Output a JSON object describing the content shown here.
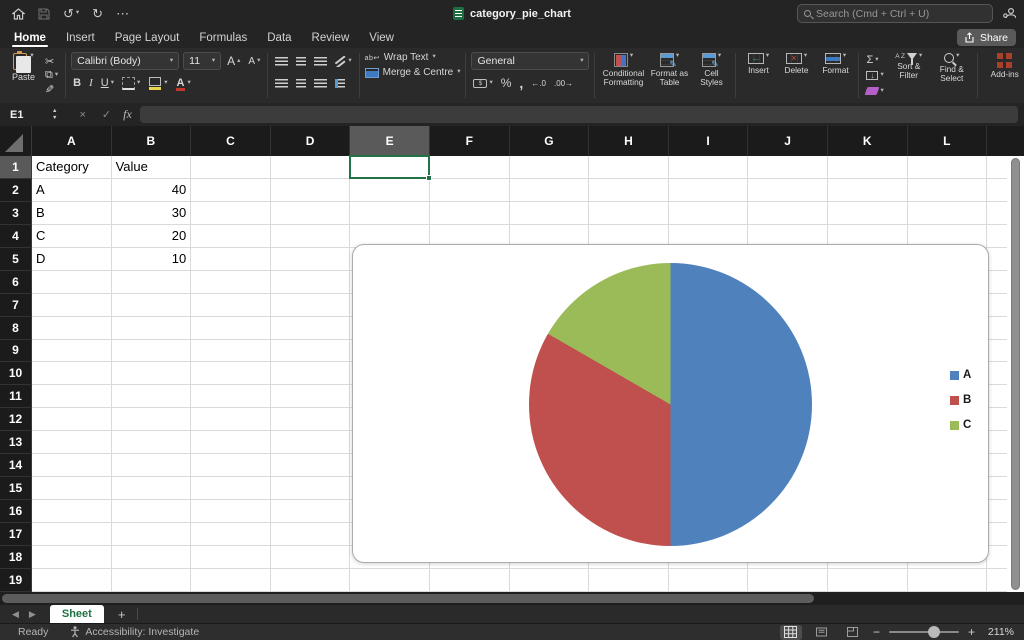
{
  "titlebar": {
    "document_title": "category_pie_chart",
    "search_placeholder": "Search (Cmd + Ctrl + U)"
  },
  "tabs": {
    "items": [
      {
        "label": "Home",
        "active": true
      },
      {
        "label": "Insert",
        "active": false
      },
      {
        "label": "Page Layout",
        "active": false
      },
      {
        "label": "Formulas",
        "active": false
      },
      {
        "label": "Data",
        "active": false
      },
      {
        "label": "Review",
        "active": false
      },
      {
        "label": "View",
        "active": false
      }
    ],
    "share_label": "Share"
  },
  "ribbon": {
    "paste_label": "Paste",
    "font_name": "Calibri (Body)",
    "font_size": "11",
    "bold": "B",
    "italic": "I",
    "underline": "U",
    "grow_font": "A",
    "shrink_font": "A",
    "wrap_text_label": "Wrap Text",
    "merge_centre_label": "Merge & Centre",
    "number_format": "General",
    "percent": "%",
    "comma": ",",
    "inc_decimal": "←.0",
    "dec_decimal": ".00→",
    "conditional_formatting_label": "Conditional Formatting",
    "format_as_table_label": "Format as Table",
    "cell_styles_label": "Cell Styles",
    "insert_label": "Insert",
    "delete_label": "Delete",
    "format_label": "Format",
    "sum_sigma": "Σ",
    "sort_az": "A Z",
    "sort_filter_label": "Sort & Filter",
    "find_select_label": "Find & Select",
    "add_ins_label": "Add-ins"
  },
  "formula_bar": {
    "name_box": "E1",
    "fx_label": "fx",
    "value": ""
  },
  "grid": {
    "columns": [
      "A",
      "B",
      "C",
      "D",
      "E",
      "F",
      "G",
      "H",
      "I",
      "J",
      "K",
      "L"
    ],
    "row_count": 19,
    "selected_cell": {
      "col": "E",
      "row": 1
    },
    "cells": {
      "A1": "Category",
      "B1": "Value",
      "A2": "A",
      "B2": 40,
      "A3": "B",
      "B3": 30,
      "A4": "C",
      "B4": 20,
      "A5": "D",
      "B5": 10
    }
  },
  "chart_data": {
    "type": "pie",
    "title": "",
    "labels": [
      "A",
      "B",
      "C"
    ],
    "values_percent": [
      50,
      33.33,
      16.67
    ],
    "colors": [
      "#4F81BD",
      "#C0504D",
      "#9BBB59"
    ],
    "start_angle_deg": 0,
    "direction": "clockwise",
    "legend_position": "right",
    "worksheet_source": {
      "categories": [
        "A",
        "B",
        "C",
        "D"
      ],
      "values": [
        40,
        30,
        20,
        10
      ]
    }
  },
  "sheet_bar": {
    "active_tab": "Sheet",
    "add_label": "+"
  },
  "status_bar": {
    "ready_label": "Ready",
    "accessibility_label": "Accessibility: Investigate",
    "zoom_percent": "211%"
  },
  "icons": {
    "undo": "↺",
    "redo": "↻",
    "more": "⋯",
    "caret": "▾",
    "caret_up": "▴",
    "up": "▲",
    "down": "▼",
    "cancel": "×",
    "confirm": "✓",
    "scissors": "✂",
    "copy": "⧉",
    "brush": "✎",
    "wrap_return": "↩",
    "fill_down": "↓",
    "left_arrow": "◀",
    "right_arrow": "▶",
    "minus": "−",
    "plus": "+",
    "insert_overlay": "←",
    "delete_overlay": "×"
  }
}
